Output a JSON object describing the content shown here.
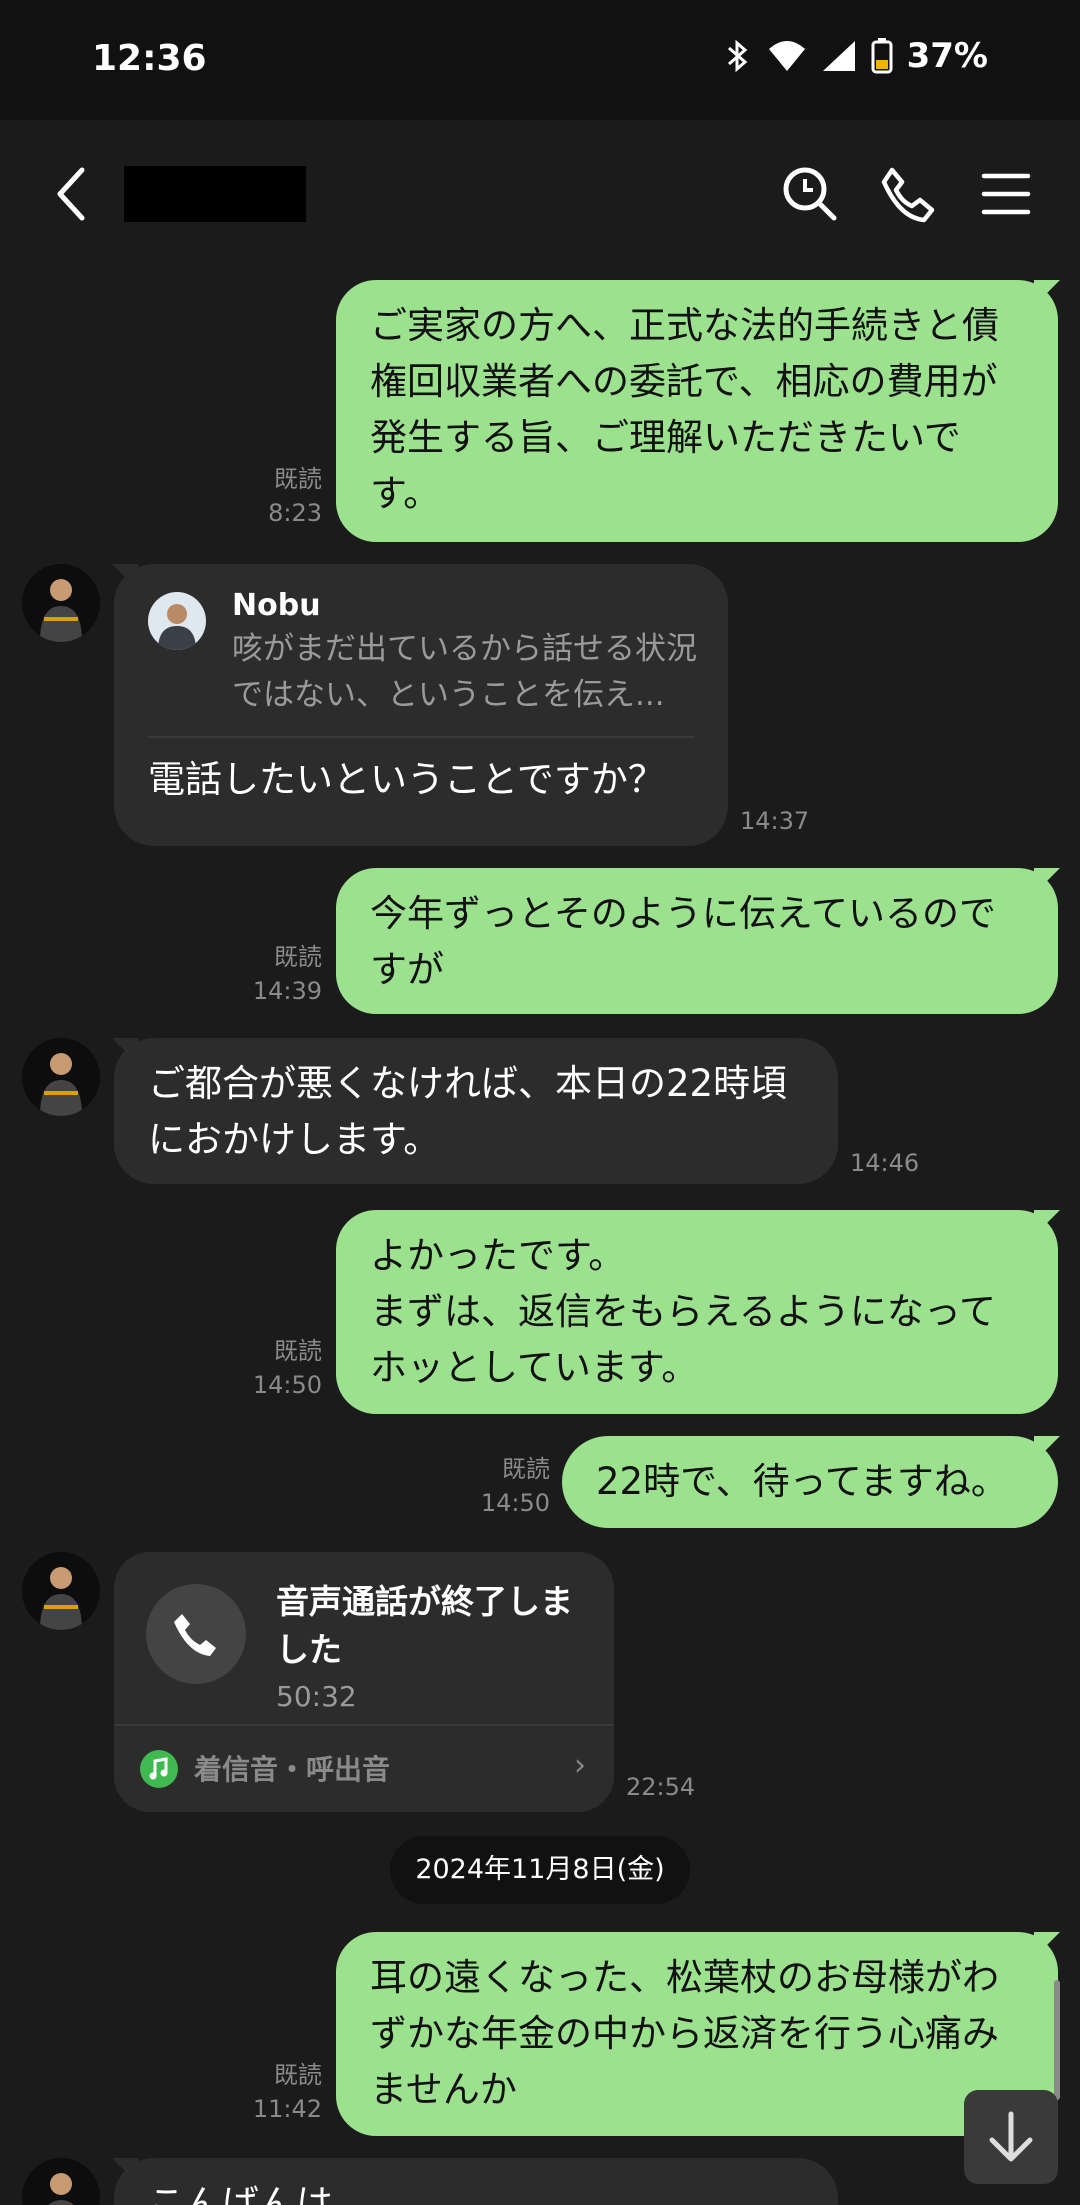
{
  "status": {
    "time": "12:36",
    "battery": "37%"
  },
  "header": {
    "back_icon": "chevron-left-icon",
    "search_icon": "search-icon",
    "call_icon": "phone-icon",
    "menu_icon": "menu-icon"
  },
  "messages": {
    "m1": {
      "text": "ご実家の方へ、正式な法的手続きと債権回収業者への委託で、相応の費用が発生する旨、ご理解いただきたいです。",
      "read": "既読",
      "time": "8:23"
    },
    "m2": {
      "quote_name": "Nobu",
      "quote_text": "咳がまだ出ているから話せる状況ではない、ということを伝え...",
      "text": "電話したいということですか？",
      "time": "14:37"
    },
    "m3": {
      "text": "今年ずっとそのように伝えているのですが",
      "read": "既読",
      "time": "14:39"
    },
    "m4": {
      "text": "ご都合が悪くなければ、本日の22時頃におかけします。",
      "time": "14:46"
    },
    "m5": {
      "line1": "よかったです。",
      "line2": "まずは、返信をもらえるようになってホッとしています。",
      "read": "既読",
      "time": "14:50"
    },
    "m6": {
      "text": "22時で、待ってますね。",
      "read": "既読",
      "time": "14:50"
    },
    "m7": {
      "title": "音声通話が終了しました",
      "duration": "50:32",
      "ringtone": "着信音・呼出音",
      "time": "22:54"
    },
    "date": "2024年11月8日(金)",
    "m8": {
      "text": "耳の遠くなった、松葉杖のお母様がわずかな年金の中から返済を行う心痛みませんか",
      "read": "既読",
      "time": "11:42"
    },
    "m9": {
      "text": "こんばんは"
    }
  },
  "colors": {
    "bg": "#1b1b1b",
    "my_bubble": "#9ce28e",
    "their_bubble": "#2c2c2c",
    "meta": "#8a8a8a"
  }
}
